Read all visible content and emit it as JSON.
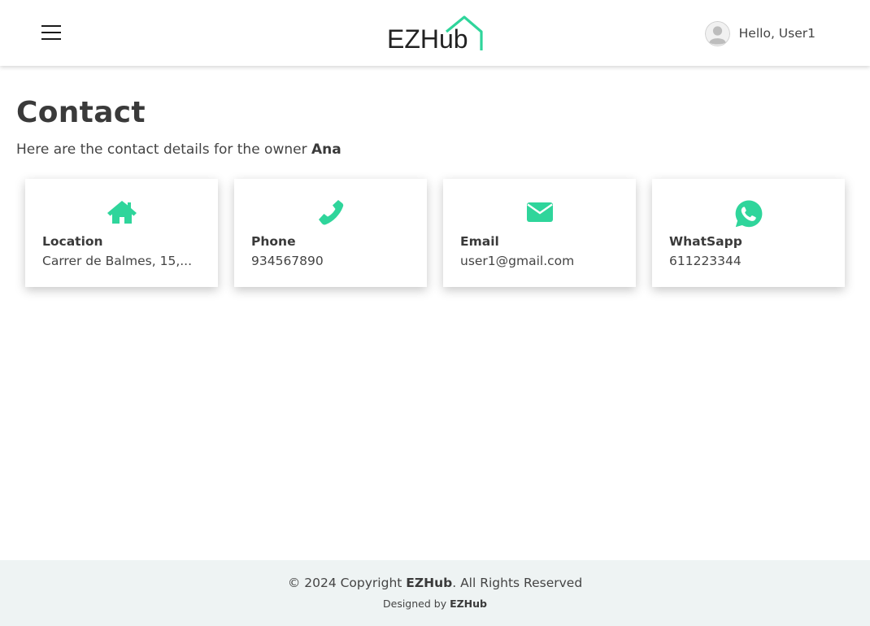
{
  "header": {
    "logo_text": "EZHub",
    "greeting": "Hello, User1",
    "icons": {
      "menu": "hamburger-menu-icon",
      "avatar": "user-avatar-icon"
    }
  },
  "page": {
    "title": "Contact",
    "subtitle_prefix": "Here are the contact details for the owner ",
    "owner_name": "Ana"
  },
  "cards": [
    {
      "icon": "home-icon",
      "label": "Location",
      "value": "Carrer de Balmes, 15,..."
    },
    {
      "icon": "phone-icon",
      "label": "Phone",
      "value": "934567890"
    },
    {
      "icon": "envelope-icon",
      "label": "Email",
      "value": "user1@gmail.com"
    },
    {
      "icon": "whatsapp-icon",
      "label": "WhatSapp",
      "value": "611223344"
    }
  ],
  "footer": {
    "copyright_prefix": "© 2024 Copyright ",
    "brand": "EZHub",
    "copyright_suffix": ". All Rights Reserved",
    "designed_prefix": "Designed by ",
    "designed_brand": "EZHub"
  },
  "colors": {
    "accent": "#2fd59b",
    "text": "#3a3a3a",
    "footer_bg": "#eef3f3"
  }
}
